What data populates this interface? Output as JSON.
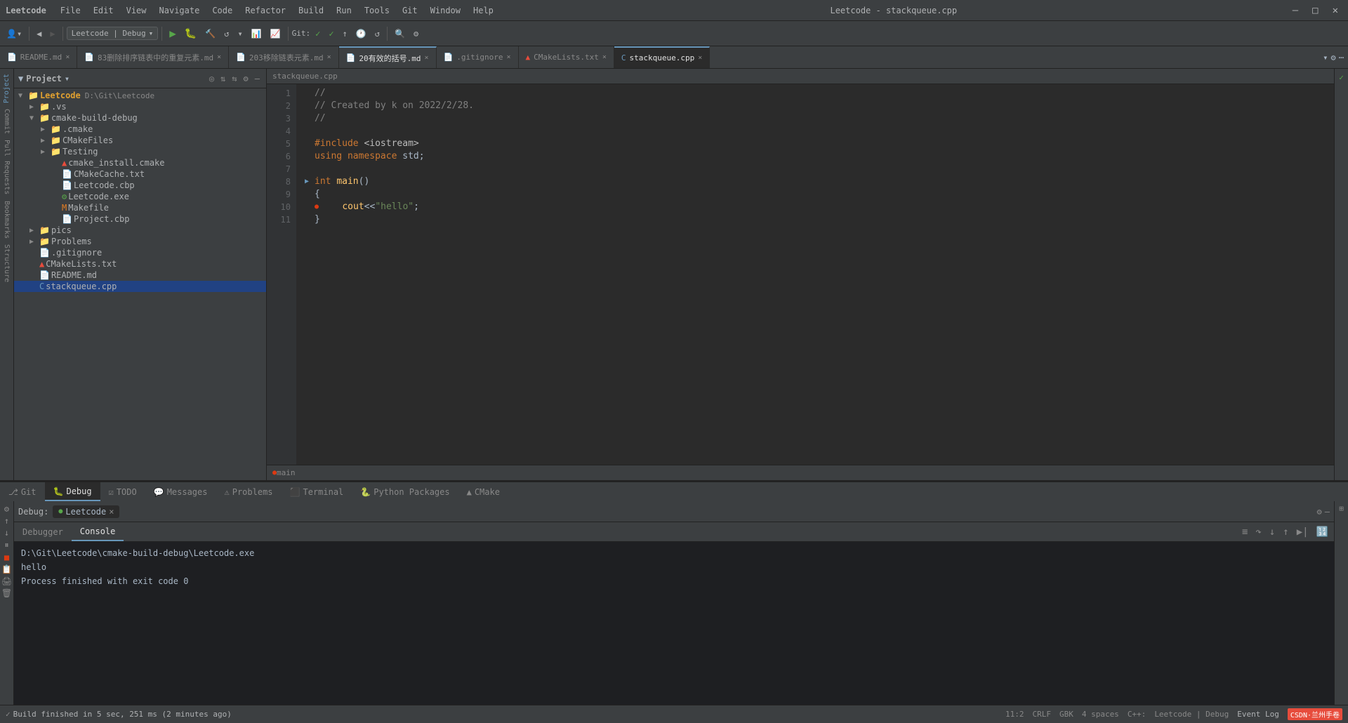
{
  "titlebar": {
    "app_name": "Leetcode",
    "file_name": "stackqueue.cpp",
    "title": "Leetcode - stackqueue.cpp",
    "menu": [
      "File",
      "Edit",
      "View",
      "Navigate",
      "Code",
      "Refactor",
      "Build",
      "Run",
      "Tools",
      "Git",
      "Window",
      "Help"
    ]
  },
  "toolbar": {
    "project_combo": "Leetcode | Debug",
    "git_label": "Git:"
  },
  "tabs": [
    {
      "label": "README.md",
      "active": false,
      "closable": true
    },
    {
      "label": "83删除排序链表中的重复元素.md",
      "active": false,
      "closable": true
    },
    {
      "label": "203移除链表元素.md",
      "active": false,
      "closable": true
    },
    {
      "label": "20有效的括号.md",
      "active": true,
      "closable": true
    },
    {
      "label": ".gitignore",
      "active": false,
      "closable": true
    },
    {
      "label": "CMakeLists.txt",
      "active": false,
      "closable": true
    },
    {
      "label": "stackqueue.cpp",
      "active": true,
      "closable": true
    }
  ],
  "project": {
    "title": "Project",
    "root": "Leetcode",
    "root_path": "D:\\Git\\Leetcode",
    "tree": [
      {
        "indent": 1,
        "type": "folder",
        "label": ".vs",
        "expanded": false
      },
      {
        "indent": 1,
        "type": "folder",
        "label": "cmake-build-debug",
        "expanded": true,
        "selected": false
      },
      {
        "indent": 2,
        "type": "folder",
        "label": ".cmake",
        "expanded": false
      },
      {
        "indent": 2,
        "type": "folder",
        "label": "CMakeFiles",
        "expanded": false
      },
      {
        "indent": 2,
        "type": "folder",
        "label": "Testing",
        "expanded": false
      },
      {
        "indent": 2,
        "type": "cmake-file",
        "label": "cmake_install.cmake"
      },
      {
        "indent": 2,
        "type": "txt-file",
        "label": "CMakeCache.txt"
      },
      {
        "indent": 2,
        "type": "cbp-file",
        "label": "Leetcode.cbp"
      },
      {
        "indent": 2,
        "type": "exe-file",
        "label": "Leetcode.exe"
      },
      {
        "indent": 2,
        "type": "makefile",
        "label": "Makefile"
      },
      {
        "indent": 2,
        "type": "cbp-file",
        "label": "Project.cbp"
      },
      {
        "indent": 1,
        "type": "folder",
        "label": "pics",
        "expanded": false
      },
      {
        "indent": 1,
        "type": "folder",
        "label": "Problems",
        "expanded": false
      },
      {
        "indent": 1,
        "type": "git-file",
        "label": ".gitignore"
      },
      {
        "indent": 1,
        "type": "cmake-list",
        "label": "CMakeLists.txt"
      },
      {
        "indent": 1,
        "type": "md-file",
        "label": "README.md"
      },
      {
        "indent": 1,
        "type": "cpp-file",
        "label": "stackqueue.cpp",
        "selected": true
      }
    ]
  },
  "editor": {
    "breadcrumb": "stackqueue.cpp",
    "lines": [
      {
        "num": 1,
        "code": "//",
        "type": "comment"
      },
      {
        "num": 2,
        "code": "// Created by k on 2022/2/28.",
        "type": "comment"
      },
      {
        "num": 3,
        "code": "//",
        "type": "comment"
      },
      {
        "num": 4,
        "code": "",
        "type": "empty"
      },
      {
        "num": 5,
        "code": "#include <iostream>",
        "type": "include"
      },
      {
        "num": 6,
        "code": "using namespace std;",
        "type": "code"
      },
      {
        "num": 7,
        "code": "",
        "type": "empty"
      },
      {
        "num": 8,
        "code": "int main()",
        "type": "code",
        "foldable": true
      },
      {
        "num": 9,
        "code": "{",
        "type": "code"
      },
      {
        "num": 10,
        "code": "    cout<<\"hello\";",
        "type": "code",
        "breakpoint": true
      },
      {
        "num": 11,
        "code": "}",
        "type": "code"
      }
    ],
    "function_bar": "main"
  },
  "debug": {
    "label": "Debug:",
    "tab_label": "Leetcode",
    "tabs": [
      {
        "label": "Debugger",
        "active": false
      },
      {
        "label": "Console",
        "active": true
      }
    ],
    "output": [
      "D:\\Git\\Leetcode\\cmake-build-debug\\Leetcode.exe",
      "hello",
      "Process finished with exit code 0"
    ]
  },
  "bottom_tabs": [
    {
      "label": "Git",
      "icon": "git"
    },
    {
      "label": "Debug",
      "icon": "debug",
      "active": true
    },
    {
      "label": "TODO",
      "icon": "todo"
    },
    {
      "label": "Messages",
      "icon": "messages"
    },
    {
      "label": "Problems",
      "icon": "problems"
    },
    {
      "label": "Terminal",
      "icon": "terminal"
    },
    {
      "label": "Python Packages",
      "icon": "python"
    },
    {
      "label": "CMake",
      "icon": "cmake"
    }
  ],
  "status_bar": {
    "build_text": "Build finished in 5 sec, 251 ms (2 minutes ago)",
    "position": "11:2",
    "encoding": "CRLF",
    "charset": "GBK",
    "indent": "4 spaces",
    "language": "C++",
    "config": "Leetcode | Debug",
    "event_log": "Event Log",
    "csdn": "CSDN·兰州手卷"
  }
}
